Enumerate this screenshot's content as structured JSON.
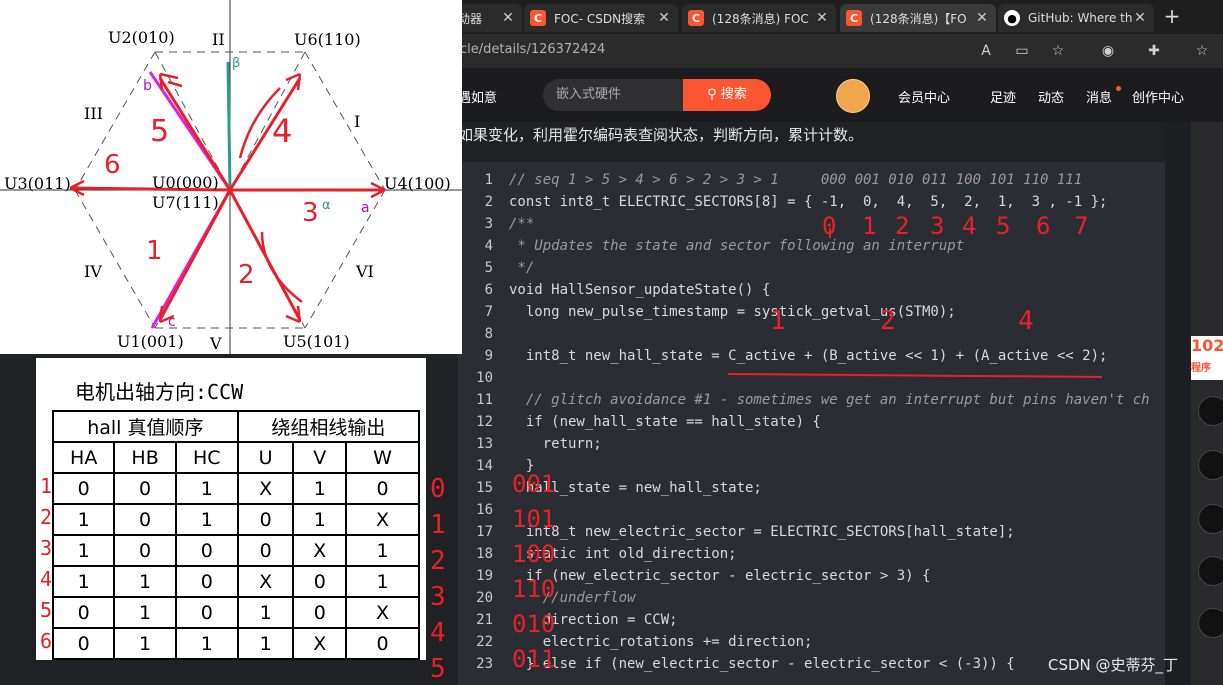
{
  "browser": {
    "tabs": [
      {
        "title": "驱动器",
        "icon": "csdn-icon"
      },
      {
        "title": "FOC- CSDN搜索",
        "icon": "csdn-icon"
      },
      {
        "title": "(128条消息) FOC",
        "icon": "csdn-icon"
      },
      {
        "title": "(128条消息)【FO",
        "icon": "csdn-icon"
      },
      {
        "title": "GitHub: Where th",
        "icon": "github-icon"
      }
    ],
    "url": "cle/details/126372424"
  },
  "header": {
    "left_text": "遇如意",
    "search_placeholder": "嵌入式硬件",
    "search_button": "搜索",
    "nav": [
      "会员中心",
      "足迹",
      "动态",
      "消息",
      "创作中心"
    ]
  },
  "article": {
    "text": "如果变化，利用霍尔编码表查阅状态，判断方向，累计计数。"
  },
  "code": {
    "lines": [
      {
        "n": "1",
        "t": "// seq 1 > 5 > 4 > 6 > 2 > 3 > 1     000 001 010 011 100 101 110 111"
      },
      {
        "n": "2",
        "t": "const int8_t ELECTRIC_SECTORS[8] = { -1,  0,  4,  5,  2,  1,  3 , -1 };"
      },
      {
        "n": "3",
        "t": "/**"
      },
      {
        "n": "4",
        "t": " * Updates the state and sector following an interrupt"
      },
      {
        "n": "5",
        "t": " */"
      },
      {
        "n": "6",
        "t": "void HallSensor_updateState() {"
      },
      {
        "n": "7",
        "t": "  long new_pulse_timestamp = systick_getval_us(STM0);"
      },
      {
        "n": "8",
        "t": ""
      },
      {
        "n": "9",
        "t": "  int8_t new_hall_state = C_active + (B_active << 1) + (A_active << 2);"
      },
      {
        "n": "10",
        "t": ""
      },
      {
        "n": "11",
        "t": "  // glitch avoidance #1 - sometimes we get an interrupt but pins haven't ch"
      },
      {
        "n": "12",
        "t": "  if (new_hall_state == hall_state) {"
      },
      {
        "n": "13",
        "t": "    return;"
      },
      {
        "n": "14",
        "t": "  }"
      },
      {
        "n": "15",
        "t": "  hall_state = new_hall_state;"
      },
      {
        "n": "16",
        "t": ""
      },
      {
        "n": "17",
        "t": "  int8_t new_electric_sector = ELECTRIC_SECTORS[hall_state];"
      },
      {
        "n": "18",
        "t": "  static int old_direction;"
      },
      {
        "n": "19",
        "t": "  if (new_electric_sector - electric_sector > 3) {"
      },
      {
        "n": "20",
        "t": "    //underflow"
      },
      {
        "n": "21",
        "t": "    direction = CCW;"
      },
      {
        "n": "22",
        "t": "    electric_rotations += direction;"
      },
      {
        "n": "23",
        "t": "  } else if (new_electric_sector - electric_sector < (-3)) {"
      }
    ]
  },
  "diagram": {
    "vectors": [
      "U2(010)",
      "U6(110)",
      "U3(011)",
      "U0(000)",
      "U7(111)",
      "U4(100)",
      "U1(001)",
      "U5(101)"
    ],
    "sectors": [
      "I",
      "II",
      "III",
      "IV",
      "V",
      "VI"
    ],
    "axes": [
      "β",
      "α"
    ],
    "phases": [
      "a",
      "b",
      "c"
    ],
    "handwritten": [
      "1",
      "2",
      "3",
      "4",
      "5",
      "6"
    ]
  },
  "table": {
    "title": "电机出轴方向:CCW",
    "group_headers": [
      "hall 真值顺序",
      "绕组相线输出"
    ],
    "columns": [
      "HA",
      "HB",
      "HC",
      "U",
      "V",
      "W"
    ],
    "rows": [
      [
        "0",
        "0",
        "1",
        "X",
        "1",
        "0"
      ],
      [
        "1",
        "0",
        "1",
        "0",
        "1",
        "X"
      ],
      [
        "1",
        "0",
        "0",
        "0",
        "X",
        "1"
      ],
      [
        "1",
        "1",
        "0",
        "X",
        "0",
        "1"
      ],
      [
        "0",
        "1",
        "0",
        "1",
        "0",
        "X"
      ],
      [
        "0",
        "1",
        "1",
        "1",
        "X",
        "0"
      ]
    ],
    "row_marks": [
      "1",
      "2",
      "3",
      "4",
      "5",
      "6"
    ]
  },
  "annotations": {
    "index_row": [
      "0",
      "1",
      "2",
      "3",
      "4",
      "5",
      "6",
      "7"
    ],
    "bit_marks": [
      "1",
      "2",
      "4"
    ],
    "state_column": [
      "001",
      "101",
      "100",
      "110",
      "010",
      "011"
    ],
    "sector_column": [
      "0",
      "1",
      "2",
      "3",
      "4",
      "5"
    ]
  },
  "watermark": "CSDN @史蒂芬_丁",
  "colors": {
    "accent": "#fc5531",
    "code_bg": "#2b2d35",
    "ink_red": "#e8202a"
  }
}
